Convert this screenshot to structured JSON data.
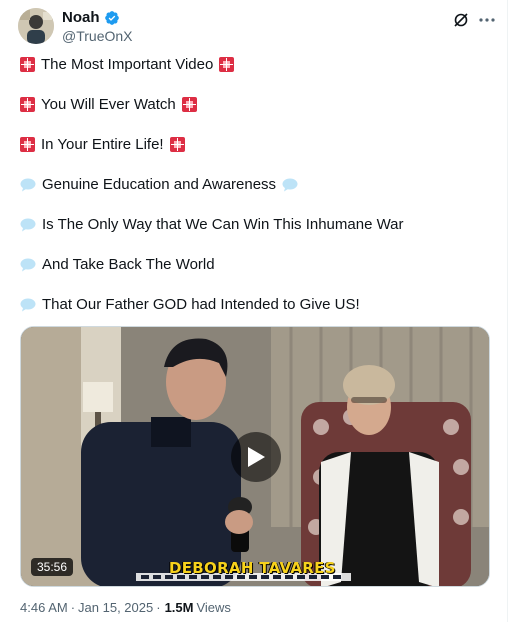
{
  "author": {
    "name": "Noah",
    "handle": "@TrueOnX",
    "verified": true,
    "verified_color": "#1d9bf0"
  },
  "tweet": {
    "lines": [
      {
        "text": "The Most Important Video",
        "emoji": "siren"
      },
      {
        "text": "You Will Ever Watch",
        "emoji": "siren"
      },
      {
        "text": "In Your Entire Life!",
        "emoji": "siren"
      },
      {
        "text": "Genuine Education and Awareness",
        "emoji": "speech-bubble"
      },
      {
        "text": "Is The Only Way that We Can Win This Inhumane War",
        "emoji": "speech-bubble"
      },
      {
        "text": "And Take Back The World",
        "emoji": "speech-bubble"
      },
      {
        "text": "That Our Father GOD had Intended to Give US!",
        "emoji": "speech-bubble"
      }
    ]
  },
  "media": {
    "duration": "35:56",
    "caption": "DEBORAH TAVARES",
    "play_icon": "play-icon"
  },
  "footer": {
    "time": "4:46 AM",
    "date": "Jan 15, 2025",
    "views_count": "1.5M",
    "views_label": "Views"
  },
  "icons": {
    "header_actions": [
      "grok-icon",
      "more-icon"
    ]
  }
}
